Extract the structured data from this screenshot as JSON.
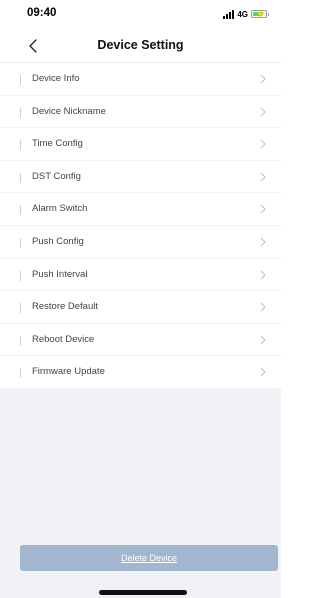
{
  "status_bar": {
    "time": "09:40",
    "network": "4G",
    "signal_icon": "signal-bars-icon",
    "battery_icon": "battery-charging-icon",
    "battery_color": "#4cd964"
  },
  "nav": {
    "title": "Device Setting",
    "back_icon": "chevron-left-icon"
  },
  "settings": {
    "items": [
      {
        "label": "Device Info"
      },
      {
        "label": "Device Nickname"
      },
      {
        "label": "Time Config"
      },
      {
        "label": "DST Config"
      },
      {
        "label": "Alarm Switch"
      },
      {
        "label": "Push Config"
      },
      {
        "label": "Push Interval"
      },
      {
        "label": "Restore Default"
      },
      {
        "label": "Reboot Device"
      },
      {
        "label": "Firmware Update"
      }
    ],
    "chevron_icon": "chevron-right-icon"
  },
  "footer": {
    "delete_label": "Delete Device",
    "delete_button_color": "#a3b6cf"
  }
}
